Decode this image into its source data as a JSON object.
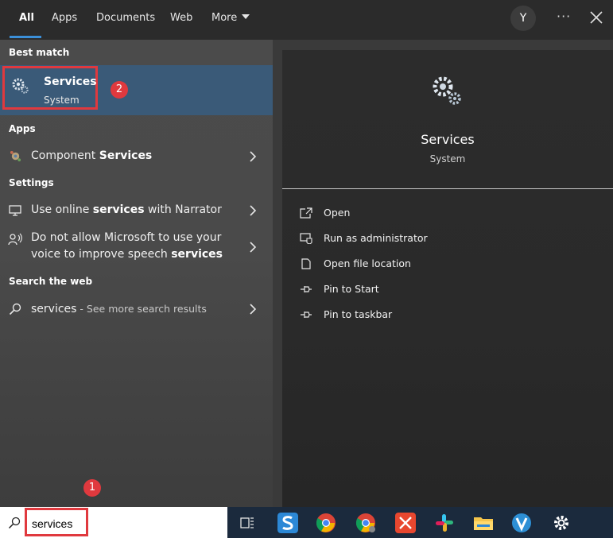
{
  "tabs": [
    {
      "label": "All",
      "active": true
    },
    {
      "label": "Apps"
    },
    {
      "label": "Documents"
    },
    {
      "label": "Web"
    },
    {
      "label": "More"
    }
  ],
  "header": {
    "avatar_initial": "Y",
    "more_options": "···"
  },
  "sections": {
    "best_match": "Best match",
    "apps": "Apps",
    "settings": "Settings",
    "search_web": "Search the web"
  },
  "best_match": {
    "title": "Services",
    "subtitle": "System",
    "annotation": "2"
  },
  "results": {
    "component": {
      "prefix": "Component ",
      "bold": "Services"
    },
    "online": {
      "prefix": "Use online ",
      "bold": "services",
      "suffix": " with Narrator"
    },
    "voice": {
      "line1": "Do not allow Microsoft to use your",
      "line2_prefix": "voice to improve speech ",
      "line2_bold": "services"
    },
    "web": {
      "query": "services",
      "hint": " - See more search results"
    }
  },
  "preview": {
    "title": "Services",
    "subtitle": "System",
    "actions": [
      "Open",
      "Run as administrator",
      "Open file location",
      "Pin to Start",
      "Pin to taskbar"
    ]
  },
  "taskbar": {
    "search_value": "services",
    "annotation": "1",
    "apps": [
      "task-view-icon",
      "snagit-icon",
      "chrome-icon",
      "chrome-canary-icon",
      "xmind-icon",
      "slack-icon",
      "file-explorer-icon",
      "vpn-icon",
      "settings-icon"
    ]
  },
  "colors": {
    "accent": "#3b8fd8",
    "highlight": "#3a5a78",
    "annotation_red": "#e0393e"
  }
}
